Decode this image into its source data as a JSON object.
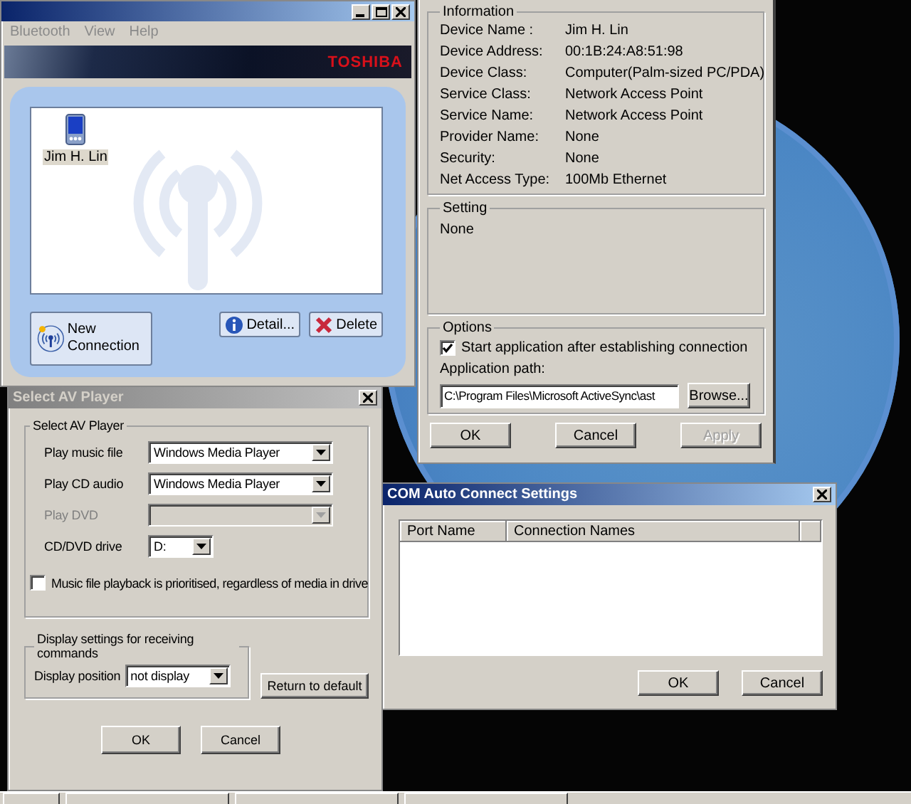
{
  "bluetooth_window": {
    "menu": [
      "Bluetooth",
      "View",
      "Help"
    ],
    "brand": "TOSHIBA",
    "devices": [
      {
        "name": "Jim H. Lin",
        "selected": true
      }
    ],
    "buttons": [
      {
        "kind": "new",
        "label": "New Connection"
      },
      {
        "kind": "detail",
        "label": "Detail..."
      },
      {
        "kind": "delete",
        "label": "Delete"
      }
    ]
  },
  "properties_dialog": {
    "information": {
      "title": "Information",
      "rows": [
        {
          "label": "Device Name :",
          "value": "Jim H. Lin"
        },
        {
          "label": "Device Address:",
          "value": "00:1B:24:A8:51:98"
        },
        {
          "label": "Device Class:",
          "value": "Computer(Palm-sized PC/PDA)"
        },
        {
          "label": "Service Class:",
          "value": "Network Access Point"
        },
        {
          "label": "Service Name:",
          "value": "Network Access Point"
        },
        {
          "label": "Provider Name:",
          "value": "None"
        },
        {
          "label": "Security:",
          "value": "None"
        },
        {
          "label": "Net Access Type:",
          "value": "100Mb Ethernet"
        }
      ]
    },
    "setting": {
      "title": "Setting",
      "value": "None"
    },
    "options": {
      "title": "Options",
      "checkbox": {
        "label": "Start application after establishing connection",
        "checked": true
      },
      "path_label": "Application path:",
      "path_value": "C:\\Program Files\\Microsoft ActiveSync\\ast",
      "browse": "Browse..."
    },
    "buttons": [
      {
        "label": "OK",
        "disabled": false
      },
      {
        "label": "Cancel",
        "disabled": false
      },
      {
        "label": "Apply",
        "disabled": true
      }
    ]
  },
  "av_player_dialog": {
    "title": "Select AV Player",
    "active": false,
    "group_title": "Select AV Player",
    "rows": [
      {
        "label": "Play music file",
        "value": "Windows Media Player",
        "disabled": false
      },
      {
        "label": "Play CD audio",
        "value": "Windows Media Player",
        "disabled": false
      },
      {
        "label": "Play DVD",
        "disabled": true
      },
      {
        "label": "CD/DVD drive",
        "value": "D:",
        "disabled": false
      }
    ],
    "checkbox": {
      "label": "Music file playback is prioritised, regardless of media in drive",
      "checked": false
    },
    "display_group": {
      "title": "Display settings for receiving commands",
      "label": "Display position",
      "value": "not display"
    },
    "reset": "Return to default",
    "buttons": [
      "OK",
      "Cancel"
    ]
  },
  "com_dialog": {
    "title": "COM Auto Connect Settings",
    "active": true,
    "columns": [
      "Port Name",
      "Connection Names"
    ],
    "buttons": [
      "OK",
      "Cancel"
    ]
  }
}
